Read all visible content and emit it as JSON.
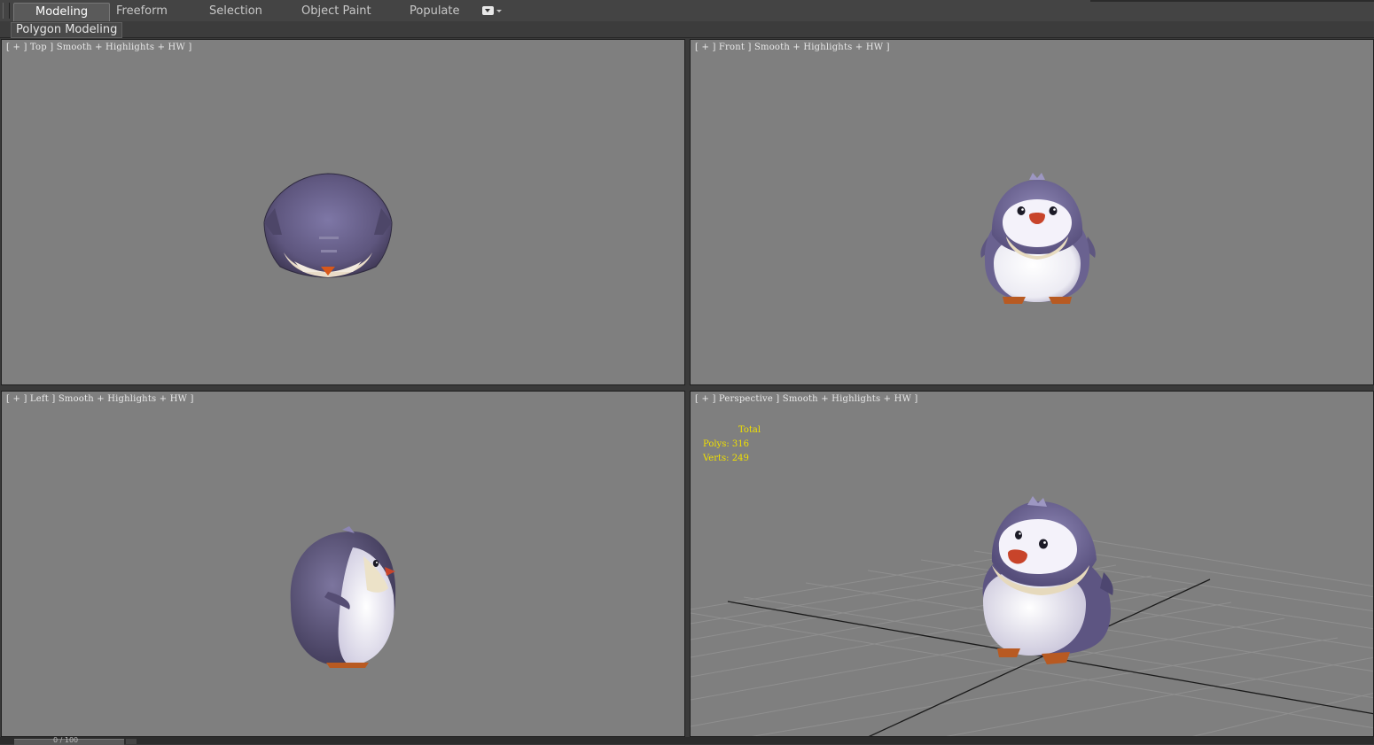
{
  "ribbon": {
    "tabs": [
      {
        "label": "Modeling",
        "active": true
      },
      {
        "label": "Freeform",
        "active": false
      },
      {
        "label": "Selection",
        "active": false
      },
      {
        "label": "Object Paint",
        "active": false
      },
      {
        "label": "Populate",
        "active": false
      }
    ],
    "panel_label": "Polygon Modeling"
  },
  "viewports": {
    "top": {
      "label": "[ + ] Top ] Smooth + Highlights + HW ]"
    },
    "front": {
      "label": "[ + ] Front ] Smooth + Highlights + HW ]"
    },
    "left": {
      "label": "[ + ] Left ] Smooth + Highlights + HW ]"
    },
    "perspective": {
      "label": "[ + ] Perspective ] Smooth + Highlights + HW ]",
      "stats": {
        "header": "Total",
        "polys_label": "Polys:",
        "polys_value": "316",
        "verts_label": "Verts:",
        "verts_value": "249"
      }
    }
  },
  "timeline": {
    "frame": "0 / 100"
  },
  "colors": {
    "viewport_bg": "#7f7f7f",
    "stats_text": "#f0e000",
    "penguin_body": "#6f6791",
    "penguin_belly": "#f2f0f6"
  }
}
